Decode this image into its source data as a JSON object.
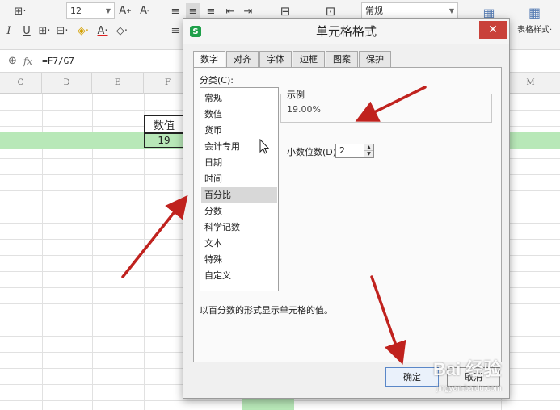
{
  "ribbon": {
    "font_size": "12",
    "number_format": "常规",
    "table_style_label": "表格样式·"
  },
  "formula_bar": {
    "fx_label": "fx",
    "formula": "=F7/G7"
  },
  "columns": [
    "C",
    "D",
    "E",
    "F",
    "M"
  ],
  "sheet": {
    "header_cell": "数值",
    "value_cell": "19"
  },
  "dialog": {
    "title": "单元格格式",
    "close_label": "✕",
    "tabs": [
      {
        "label": "数字",
        "active": true
      },
      {
        "label": "对齐"
      },
      {
        "label": "字体"
      },
      {
        "label": "边框"
      },
      {
        "label": "图案"
      },
      {
        "label": "保护"
      }
    ],
    "category_label": "分类(C):",
    "categories": [
      "常规",
      "数值",
      "货币",
      "会计专用",
      "日期",
      "时间",
      "百分比",
      "分数",
      "科学记数",
      "文本",
      "特殊",
      "自定义"
    ],
    "selected_category": "百分比",
    "sample_label": "示例",
    "sample_value": "19.00%",
    "decimals_label": "小数位数(D):",
    "decimals_value": "2",
    "description": "以百分数的形式显示单元格的值。",
    "ok_label": "确定",
    "cancel_label": "取消"
  },
  "watermark": {
    "brand": "Bai 经验",
    "url": "jingyan.baidu.com"
  },
  "colors": {
    "highlight": "#b8e8b8",
    "arrow": "#c0221e",
    "close_button": "#c9413a"
  }
}
